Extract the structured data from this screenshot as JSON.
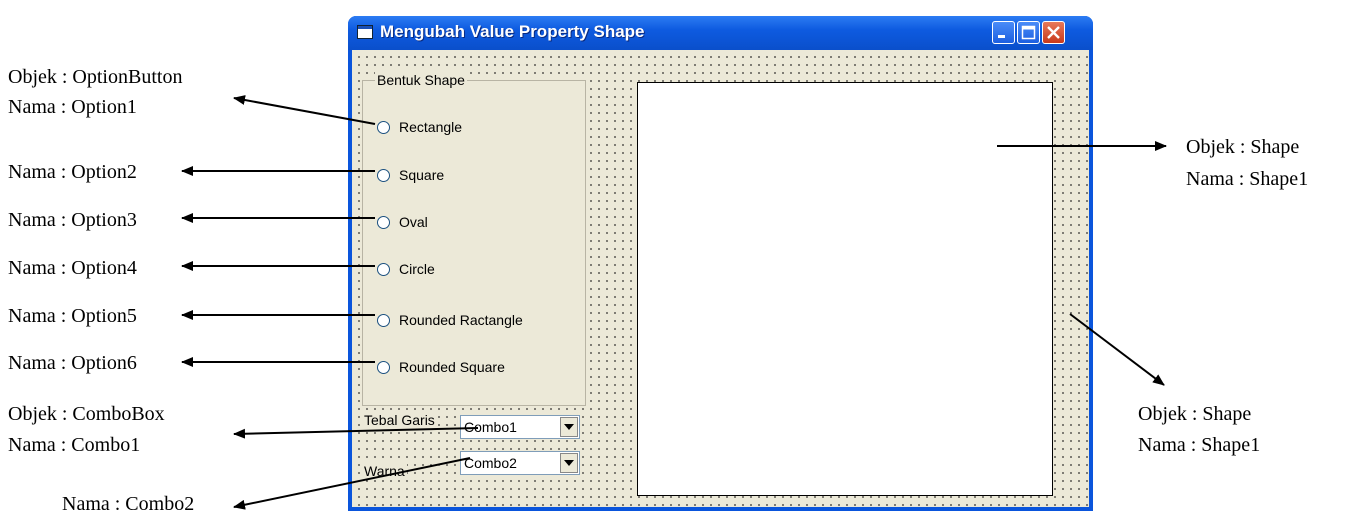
{
  "window": {
    "title": "Mengubah Value Property Shape",
    "frame_caption": "Bentuk Shape",
    "options": [
      {
        "label": "Rectangle"
      },
      {
        "label": "Square"
      },
      {
        "label": "Oval"
      },
      {
        "label": "Circle"
      },
      {
        "label": "Rounded Ractangle"
      },
      {
        "label": "Rounded Square"
      }
    ],
    "tebal_label": "Tebal Garis",
    "warna_label": "Warna",
    "combo1_value": "Combo1",
    "combo2_value": "Combo2"
  },
  "annotations": {
    "optionbutton_obj": "Objek : OptionButton",
    "option1": "Nama : Option1",
    "option2": "Nama : Option2",
    "option3": "Nama : Option3",
    "option4": "Nama : Option4",
    "option5": "Nama : Option5",
    "option6": "Nama : Option6",
    "combobox_obj": "Objek : ComboBox",
    "combo1": "Nama : Combo1",
    "combo2": "Nama : Combo2",
    "shape_obj_1": "Objek : Shape",
    "shape1_name_1": "Nama : Shape1",
    "shape_obj_2": "Objek : Shape",
    "shape1_name_2": "Nama : Shape1"
  },
  "colors": {
    "titlebar": "#0a55dc",
    "window_face": "#ece9d8",
    "close_button": "#c8391b"
  }
}
